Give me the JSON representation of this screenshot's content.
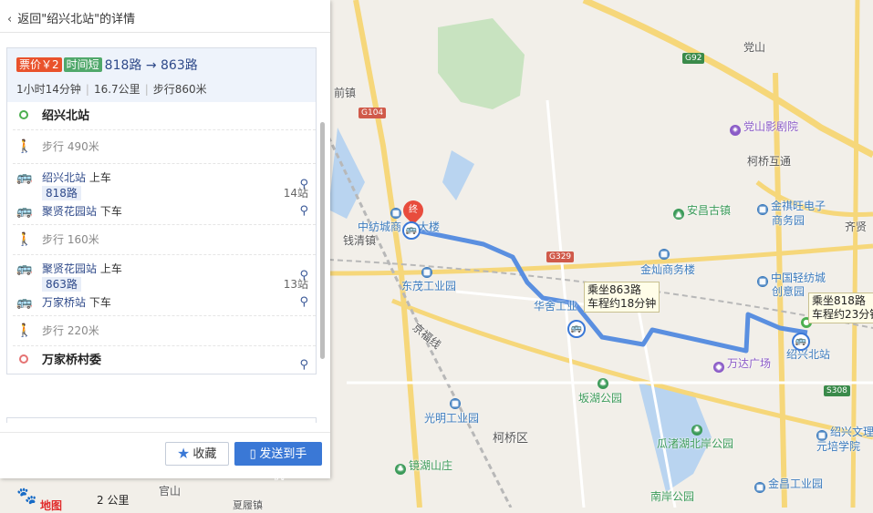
{
  "panel": {
    "back_label": "返回\"绍兴北站\"的详情",
    "route": {
      "price_tag": "票价￥2",
      "time_tag": "时间短",
      "title": "818路 → 863路",
      "duration": "1小时14分钟",
      "distance": "16.7公里",
      "walk": "步行860米"
    },
    "steps": {
      "start": "绍兴北站",
      "walk1": "步行 490米",
      "board1_stop": "绍兴北站",
      "board1_action": "上车",
      "line1": "818路",
      "line1_stops": "14站",
      "alight1_stop": "聚贤花园站",
      "alight1_action": "下车",
      "walk2": "步行 160米",
      "board2_stop": "聚贤花园站",
      "board2_action": "上车",
      "line2": "863路",
      "line2_stops": "13站",
      "alight2_stop": "万家桥站",
      "alight2_action": "下车",
      "walk3": "步行 220米",
      "end": "万家桥村委"
    },
    "buttons": {
      "favorite": "收藏",
      "send": "发送到手机"
    }
  },
  "map": {
    "places": {
      "qianqingzhen_top": "前镇",
      "dangshan": "党山",
      "dangshan_theater": "党山影剧院",
      "keqiao_interchange": "柯桥互通",
      "jinqiwang": "金祺旺电子",
      "jinqiwang2": "商务园",
      "anchangguzhen": "安昌古镇",
      "zhongfang": "中纺城商",
      "zhongfang2": "大楼",
      "qianqingzhen": "钱清镇",
      "jincan": "金灿商务楼",
      "qixian": "齐贤",
      "dongmao": "东茂工业园",
      "huashe": "华舍工业",
      "qingfang": "中国轻纺城",
      "qingfang2": "创意园",
      "jingfuxian": "京福线",
      "wanda": "万达广场",
      "shaoxingbeizhan": "绍兴北站",
      "potang": "坂湖公园",
      "guangming": "光明工业园",
      "keqiaoqu": "柯桥区",
      "guazhu": "瓜渚湖北岸公园",
      "jinghu": "镜湖山庄",
      "jinyun": "金昌工业园",
      "nanan": "南岸公园",
      "guanshan": "官山",
      "xiayuan": "夏履镇",
      "wenli": "绍兴文理",
      "wenli2": "元培学院"
    },
    "roads": {
      "g92": "G92",
      "g104": "G104",
      "g329": "G329",
      "s308": "S308"
    },
    "tooltips": {
      "t863_line1": "乘坐863路",
      "t863_line2": "车程约18分钟",
      "t818_line1": "乘坐818路",
      "t818_line2": "车程约23分钟"
    },
    "end_marker": "终",
    "scale": "2 公里",
    "logo_text": "地图"
  },
  "colors": {
    "route": "#5a8fe0",
    "accent": "#3a78d6",
    "price": "#e9522c",
    "time": "#50a86b"
  }
}
